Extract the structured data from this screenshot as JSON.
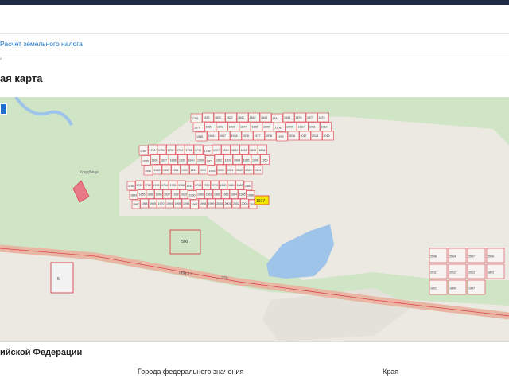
{
  "header": {
    "nav_link": "Расчет земельного налога",
    "breadcrumb": "э"
  },
  "page": {
    "title": "ая карта"
  },
  "map": {
    "plots_top": [
      "1798",
      "1812",
      "1821",
      "1822",
      "1841",
      "1842",
      "1843",
      "1844",
      "1845",
      "1876",
      "1877",
      "1878",
      "1879",
      "1880",
      "1892",
      "1893",
      "1894",
      "1895",
      "1896",
      "1908",
      "1909",
      "1910",
      "1911",
      "1912",
      "1945",
      "1946",
      "1947",
      "1948",
      "1976",
      "1977",
      "1978",
      "1979",
      "2016",
      "2017",
      "2018",
      "2019"
    ],
    "plots_mid": [
      "1789",
      "1790",
      "1791",
      "1792",
      "1793",
      "1794",
      "1795",
      "1796",
      "1797",
      "1830",
      "1831",
      "1832",
      "1833",
      "1834",
      "1835",
      "1836",
      "1837",
      "1838",
      "1839",
      "1840",
      "1900",
      "1901",
      "1902",
      "1903",
      "1904",
      "1905",
      "1906",
      "1950",
      "1951",
      "1952",
      "1953",
      "1954",
      "1990",
      "1991",
      "1992",
      "1993",
      "2020",
      "2021",
      "2022",
      "2023",
      "2024"
    ],
    "plots_low": [
      "1760",
      "1761",
      "1762",
      "1763",
      "1764",
      "1765",
      "1766",
      "1767",
      "1768",
      "1769",
      "1770",
      "1860",
      "1861",
      "1862",
      "1863",
      "1864",
      "1865",
      "1866",
      "1926",
      "1927",
      "1928",
      "1929",
      "1930",
      "1960",
      "1961",
      "1962",
      "1963",
      "1964",
      "1965",
      "1966",
      "1967",
      "1968",
      "1969",
      "1970",
      "1994",
      "1995",
      "1996",
      "1997",
      "1998",
      "1999",
      "2000",
      "2001",
      "2002",
      "2003",
      "2004"
    ],
    "plot_special": [
      "500",
      "6",
      "2008",
      "2014",
      "2007",
      "2009",
      "2011",
      "2012",
      "2013",
      "1803",
      "1801",
      "1800",
      "1997"
    ],
    "highlight_label": "1937",
    "road_label_1": "06Н-17",
    "road_label_2": "328",
    "cemetery_label": "Кладбище"
  },
  "section": {
    "title": "ийской Федерации",
    "col_a": "Города федерального значения",
    "col_b": "Края"
  },
  "colors": {
    "forest": "#c9e2c1",
    "field": "#ece9e2",
    "water": "#9fc4ea",
    "plot_line": "#d9434e",
    "road": "#e8b6a2",
    "highlight": "#f2e600"
  }
}
